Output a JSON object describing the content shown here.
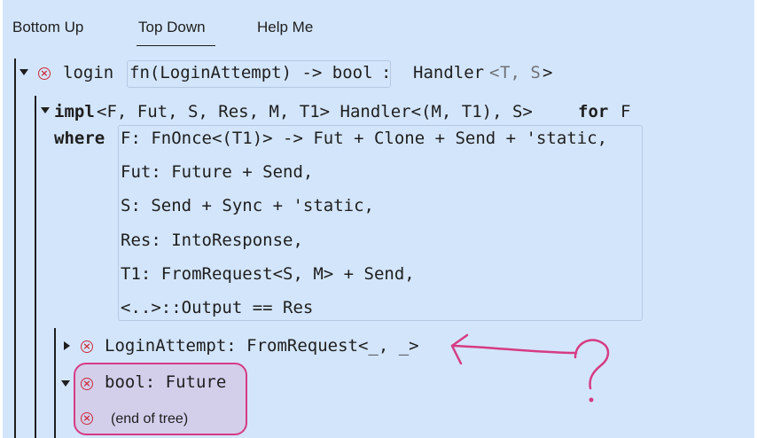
{
  "tabs": [
    {
      "label": "Bottom Up"
    },
    {
      "label": "Top Down"
    },
    {
      "label": "Help Me"
    }
  ],
  "root": {
    "name": "login",
    "signature": "fn(LoginAttempt) -> bool",
    "colon": ":",
    "bound_type": "Handler",
    "bound_open": "<",
    "bound_params": "T, S",
    "bound_close": ">"
  },
  "impl": {
    "keyword": "impl",
    "header": "<F, Fut, S, Res, M, T1> Handler<(M, T1), S>",
    "for_keyword": "for",
    "for_type": "F",
    "where_keyword": "where",
    "clauses": [
      "F: FnOnce<(T1)> -> Fut + Clone + Send + 'static,",
      "Fut: Future + Send,",
      "S: Send + Sync + 'static,",
      "Res: IntoResponse,",
      "T1: FromRequest<S, M> + Send,",
      "<..>::Output == Res"
    ]
  },
  "children": [
    {
      "label": "LoginAttempt: FromRequest<_, _>"
    },
    {
      "label": "bool: Future"
    }
  ],
  "end_of_tree": "(end of tree)",
  "annotation": {
    "mark": "?",
    "color": "#d63b84"
  },
  "colors": {
    "panel": "#d3e5fb",
    "error": "#cc2a3c",
    "highlight": "#d63b84"
  }
}
